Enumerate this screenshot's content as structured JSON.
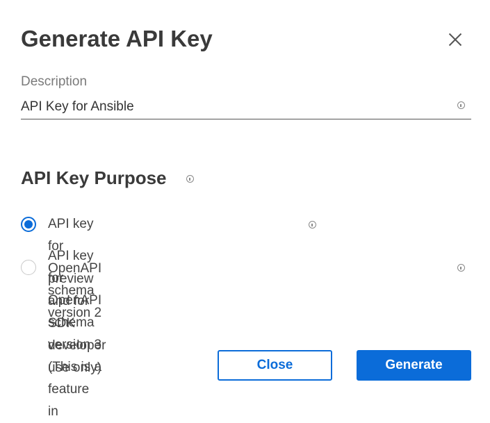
{
  "dialog": {
    "title": "Generate API Key",
    "close_icon": "close-x-icon"
  },
  "description": {
    "label": "Description",
    "value": "API Key for Ansible",
    "info_icon": "info-icon"
  },
  "purpose": {
    "heading": "API Key Purpose",
    "options": [
      {
        "label": "API key for OpenAPI schema version 2",
        "selected": true
      },
      {
        "label_line1": "API key for OpenAPI schema version 3 (This is a feature in",
        "label_line2": "preview and for SDK developer use only)",
        "selected": false
      }
    ]
  },
  "buttons": {
    "close_label": "Close",
    "generate_label": "Generate"
  },
  "colors": {
    "accent": "#0b6cd9",
    "title_text": "#3a3a3a",
    "label_text": "#7a7a7a"
  }
}
